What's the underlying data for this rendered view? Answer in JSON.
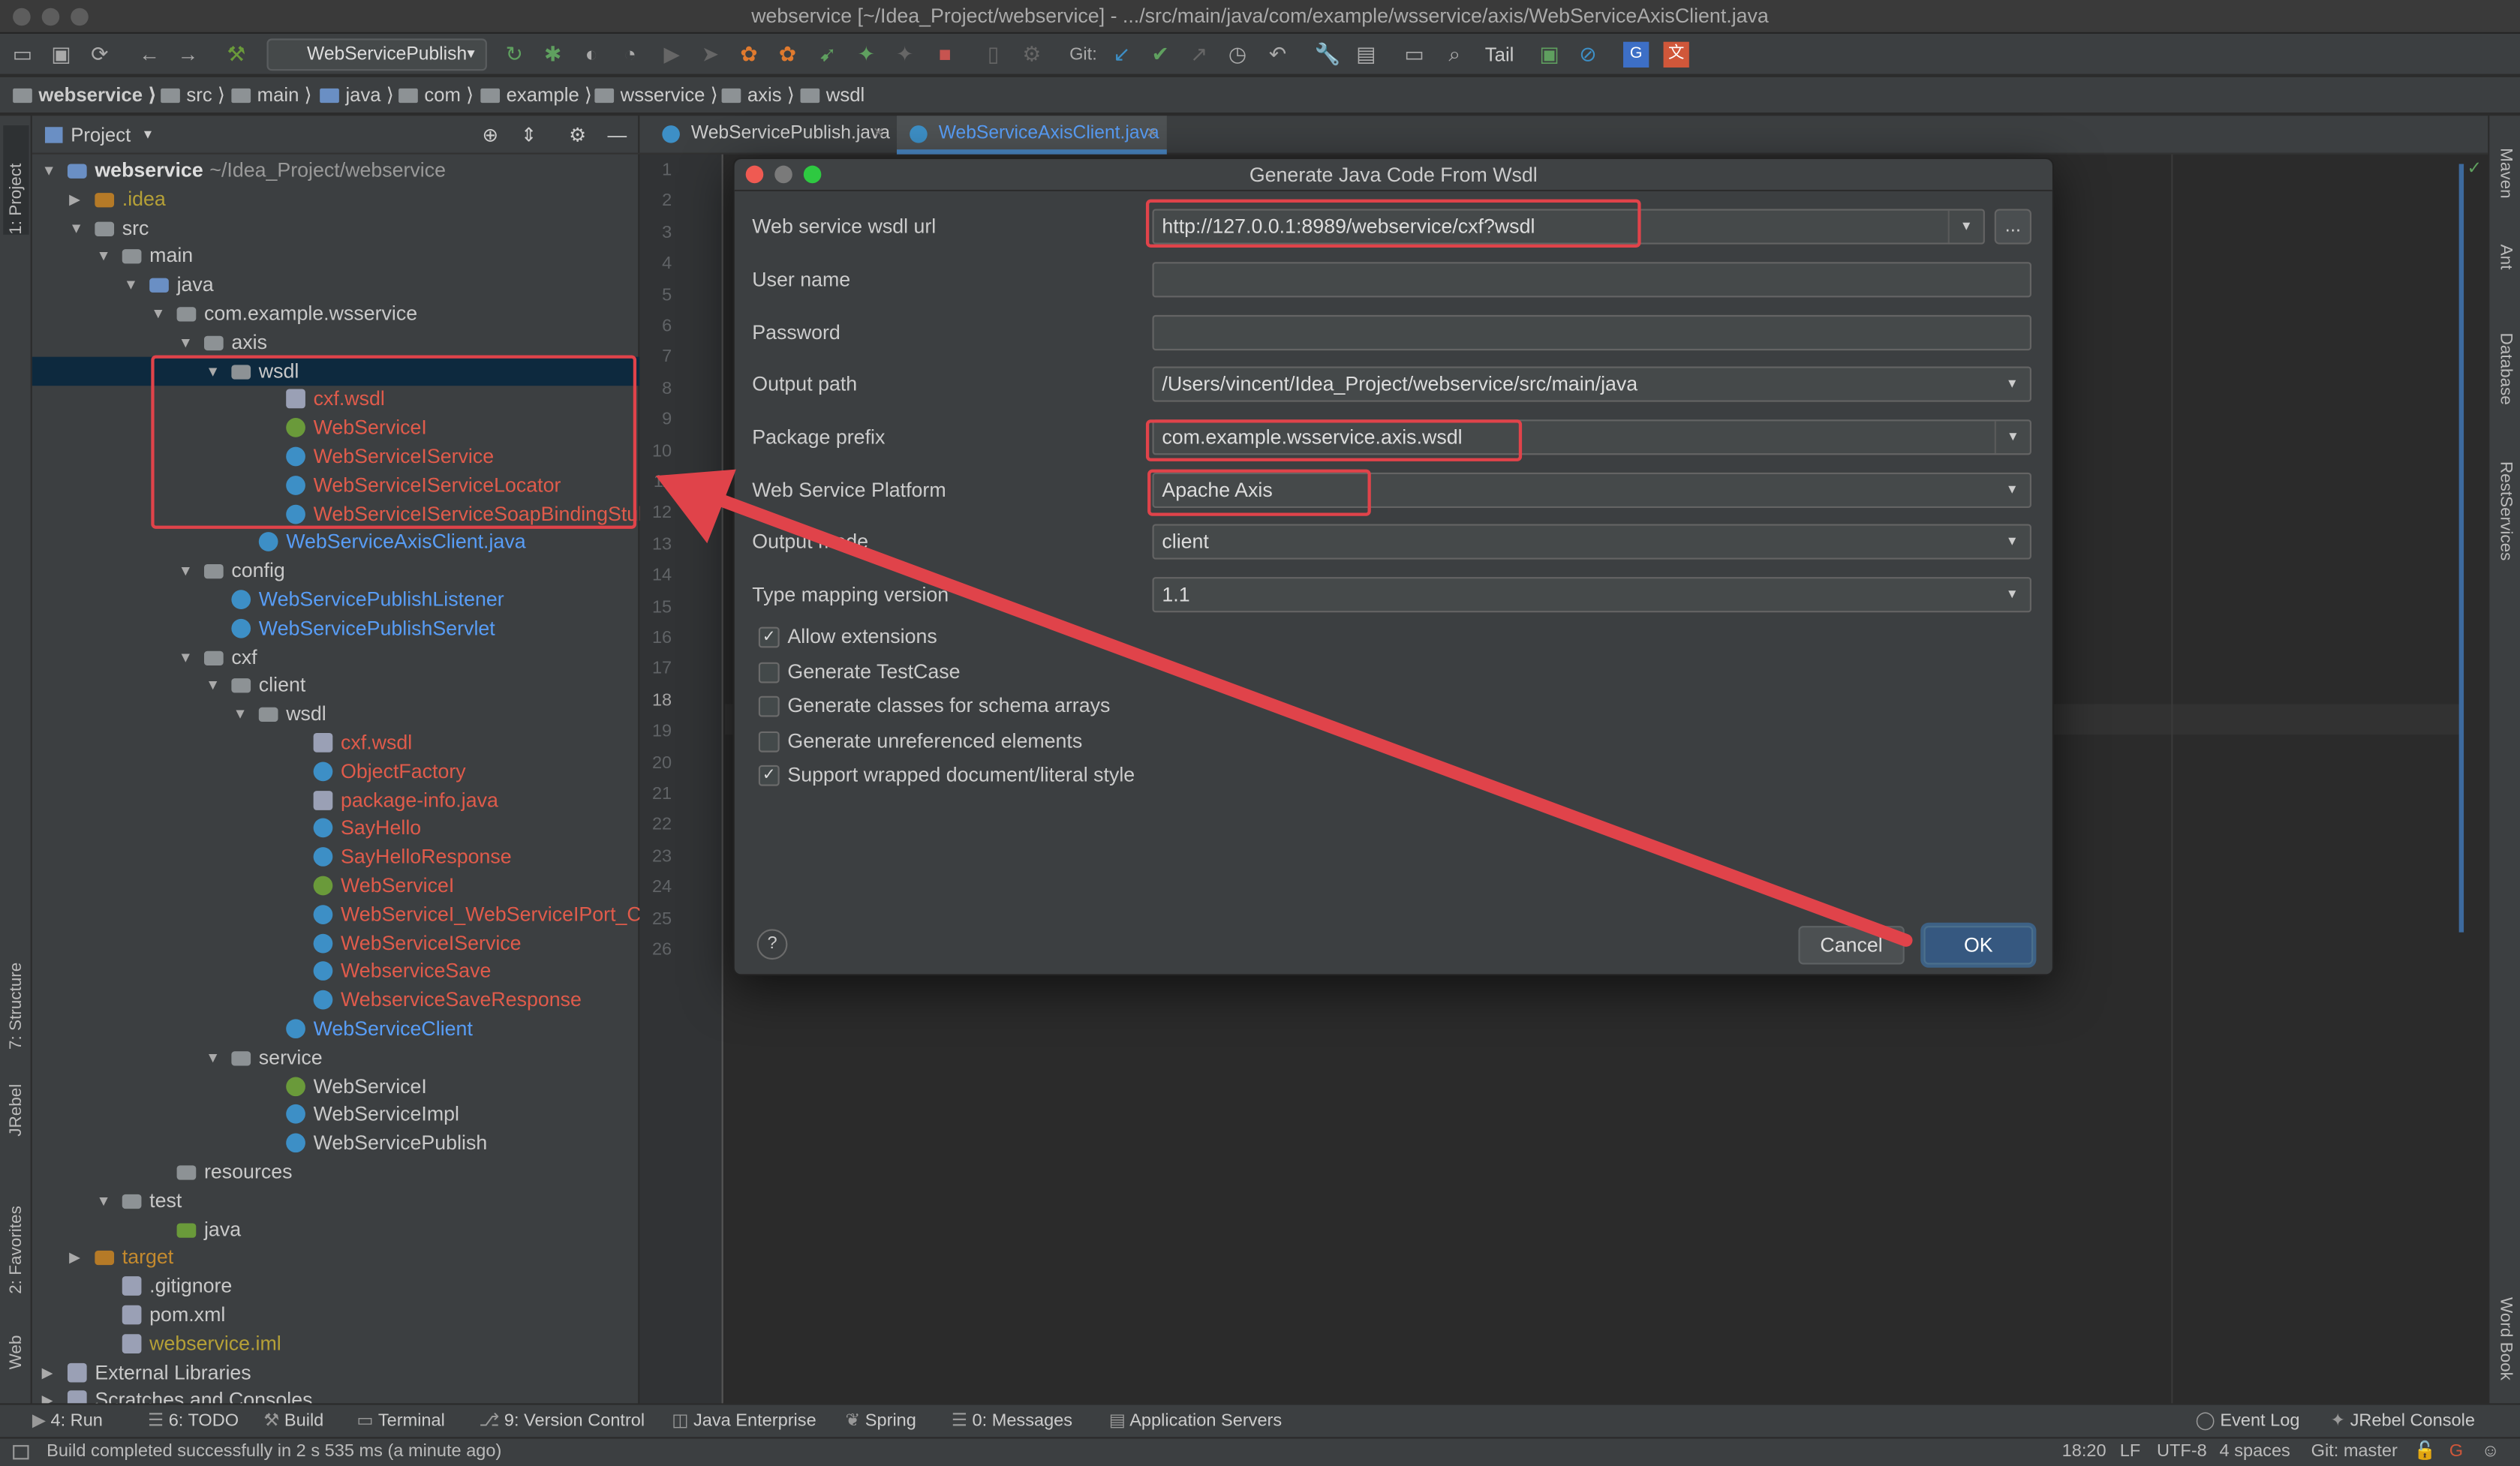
{
  "window": {
    "title": "webservice [~/Idea_Project/webservice] - .../src/main/java/com/example/wsservice/axis/WebServiceAxisClient.java"
  },
  "toolbar": {
    "run_config": "WebServicePublish",
    "git_label": "Git:",
    "tail_label": "Tail"
  },
  "breadcrumb": [
    "webservice",
    "src",
    "main",
    "java",
    "com",
    "example",
    "wsservice",
    "axis",
    "wsdl"
  ],
  "left_tabs": {
    "project": "1: Project",
    "structure": "7: Structure",
    "jrebel": "JRebel",
    "favorites": "2: Favorites",
    "web": "Web"
  },
  "right_tabs": {
    "maven": "Maven",
    "ant": "Ant",
    "database": "Database",
    "rest": "RestServices",
    "wordbook": "Word Book"
  },
  "project": {
    "header": "Project",
    "root_name": "webservice",
    "root_path": "~/Idea_Project/webservice",
    "items": [
      ".idea",
      "src",
      "main",
      "java",
      "com.example.wsservice",
      "axis",
      "wsdl",
      "cxf.wsdl",
      "WebServiceI",
      "WebServiceIService",
      "WebServiceIServiceLocator",
      "WebServiceIServiceSoapBindingStub",
      "WebServiceAxisClient.java",
      "config",
      "WebServicePublishListener",
      "WebServicePublishServlet",
      "cxf",
      "client",
      "wsdl",
      "cxf.wsdl",
      "ObjectFactory",
      "package-info.java",
      "SayHello",
      "SayHelloResponse",
      "WebServiceI",
      "WebServiceI_WebServiceIPort_Client",
      "WebServiceIService",
      "WebserviceSave",
      "WebserviceSaveResponse",
      "WebServiceClient",
      "service",
      "WebServiceI",
      "WebServiceImpl",
      "WebServicePublish",
      "resources",
      "test",
      "java",
      "target",
      ".gitignore",
      "pom.xml",
      "webservice.iml",
      "External Libraries",
      "Scratches and Consoles"
    ]
  },
  "editor": {
    "tabs": [
      "WebServicePublish.java",
      "WebServiceAxisClient.java"
    ],
    "line_numbers": [
      "1",
      "2",
      "3",
      "4",
      "5",
      "6",
      "7",
      "8",
      "9",
      "10",
      "11",
      "12",
      "13",
      "14",
      "15",
      "16",
      "17",
      "18",
      "19",
      "20",
      "21",
      "22",
      "23",
      "24",
      "25",
      "26"
    ]
  },
  "dialog": {
    "title": "Generate Java Code From Wsdl",
    "labels": {
      "wsdl_url": "Web service wsdl url",
      "user": "User name",
      "password": "Password",
      "output_path": "Output path",
      "package_prefix": "Package prefix",
      "platform": "Web Service Platform",
      "output_mode": "Output mode",
      "type_mapping": "Type mapping version"
    },
    "values": {
      "wsdl_url": "http://127.0.0.1:8989/webservice/cxf?wsdl",
      "user": "",
      "password": "",
      "output_path": "/Users/vincent/Idea_Project/webservice/src/main/java",
      "package_prefix": "com.example.wsservice.axis.wsdl",
      "platform": "Apache Axis",
      "output_mode": "client",
      "type_mapping": "1.1"
    },
    "browse": "...",
    "checkboxes": [
      {
        "label": "Allow extensions",
        "checked": true
      },
      {
        "label": "Generate TestCase",
        "checked": false
      },
      {
        "label": "Generate classes for schema arrays",
        "checked": false
      },
      {
        "label": "Generate unreferenced elements",
        "checked": false
      },
      {
        "label": "Support wrapped document/literal style",
        "checked": true
      }
    ],
    "help": "?",
    "cancel": "Cancel",
    "ok": "OK"
  },
  "bottom_tabs": [
    "4: Run",
    "6: TODO",
    "Build",
    "Terminal",
    "9: Version Control",
    "Java Enterprise",
    "Spring",
    "0: Messages",
    "Application Servers",
    "Event Log",
    "JRebel Console"
  ],
  "status": {
    "message": "Build completed successfully in 2 s 535 ms (a minute ago)",
    "position": "18:20",
    "line_sep": "LF",
    "encoding": "UTF-8",
    "indent": "4 spaces",
    "git": "Git: master"
  },
  "colors": {
    "annotation": "#e0434a",
    "accent": "#365880"
  }
}
